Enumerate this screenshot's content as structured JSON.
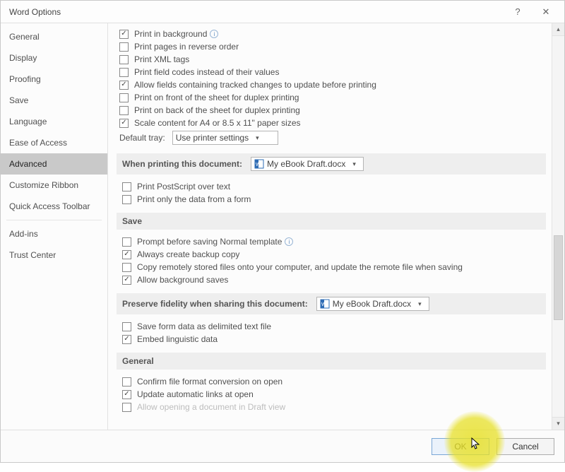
{
  "title": "Word Options",
  "sidebar": {
    "items": [
      {
        "label": "General"
      },
      {
        "label": "Display"
      },
      {
        "label": "Proofing"
      },
      {
        "label": "Save"
      },
      {
        "label": "Language"
      },
      {
        "label": "Ease of Access"
      },
      {
        "label": "Advanced",
        "selected": true
      },
      {
        "label": "Customize Ribbon"
      },
      {
        "label": "Quick Access Toolbar"
      },
      {
        "label": "Add-ins"
      },
      {
        "label": "Trust Center"
      }
    ]
  },
  "printing": {
    "print_in_background": {
      "label": "Print in background",
      "checked": true,
      "info": true,
      "ul": "b"
    },
    "print_reverse": {
      "label": "Print pages in reverse order",
      "checked": false,
      "ul": "r"
    },
    "print_xml": {
      "label": "Print XML tags",
      "checked": false,
      "ul": "X"
    },
    "print_field_codes": {
      "label": "Print field codes instead of their values",
      "checked": false,
      "ul": "f"
    },
    "allow_tracked": {
      "label": "Allow fields containing tracked changes to update before printing",
      "checked": true,
      "ul": "t"
    },
    "print_front_duplex": {
      "label": "Print on front of the sheet for duplex printing",
      "checked": false,
      "ul": "f"
    },
    "print_back_duplex": {
      "label": "Print on back of the sheet for duplex printing",
      "checked": false,
      "ul": "k"
    },
    "scale_a4": {
      "label": "Scale content for A4 or 8.5 x 11\" paper sizes",
      "checked": true,
      "ul": "A"
    },
    "default_tray_label": "Default tray:",
    "default_tray_value": "Use printer settings"
  },
  "printing_doc": {
    "header": "When printing this document:",
    "doc_name": "My eBook Draft.docx",
    "print_postscript": {
      "label": "Print PostScript over text",
      "checked": false,
      "ul": "P"
    },
    "print_form_data": {
      "label": "Print only the data from a form",
      "checked": false,
      "ul": "d"
    }
  },
  "save": {
    "header": "Save",
    "prompt_normal": {
      "label": "Prompt before saving Normal template",
      "checked": false,
      "info": true,
      "ul": "o"
    },
    "always_backup": {
      "label": "Always create backup copy",
      "checked": true,
      "ul": "b"
    },
    "copy_remote": {
      "label": "Copy remotely stored files onto your computer, and update the remote file when saving",
      "checked": false,
      "ul": "r"
    },
    "allow_bg_saves": {
      "label": "Allow background saves",
      "checked": true,
      "ul": "A"
    }
  },
  "fidelity": {
    "header": "Preserve fidelity when sharing this document:",
    "doc_name": "My eBook Draft.docx",
    "save_form_delim": {
      "label": "Save form data as delimited text file",
      "checked": false,
      "ul": "d"
    },
    "embed_ling": {
      "label": "Embed linguistic data",
      "checked": true
    }
  },
  "general": {
    "header": "General",
    "confirm_convert": {
      "label": "Confirm file format conversion on open",
      "checked": false
    },
    "update_links": {
      "label": "Update automatic links at open",
      "checked": true
    },
    "allow_draft": {
      "label": "Allow opening a document in Draft view",
      "checked": false
    }
  },
  "buttons": {
    "ok": "OK",
    "cancel": "Cancel"
  }
}
